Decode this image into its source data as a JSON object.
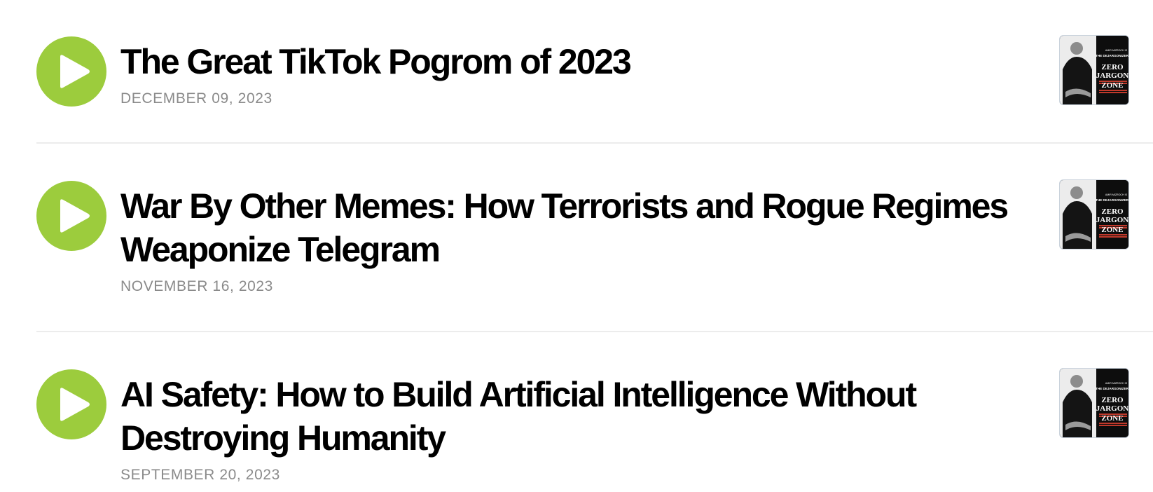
{
  "accent_color": "#9ccc3d",
  "episodes": [
    {
      "title": "The Great TikTok Pogrom of 2023",
      "date": "DECEMBER 09, 2023",
      "play_icon": "play-icon",
      "cover": {
        "byline": "AMIR MIZROCH IS",
        "show": "THE DEJARGONIZER",
        "line1": "ZERO",
        "line2": "JARGON",
        "line3": "ZONE"
      }
    },
    {
      "title": "War By Other Memes: How Terrorists and Rogue Regimes Weaponize Telegram",
      "date": "NOVEMBER 16, 2023",
      "play_icon": "play-icon",
      "cover": {
        "byline": "AMIR MIZROCH IS",
        "show": "THE DEJARGONIZER",
        "line1": "ZERO",
        "line2": "JARGON",
        "line3": "ZONE"
      }
    },
    {
      "title": "AI Safety: How to Build Artificial Intelligence Without Destroying Humanity",
      "date": "SEPTEMBER 20, 2023",
      "play_icon": "play-icon",
      "cover": {
        "byline": "AMIR MIZROCH IS",
        "show": "THE DEJARGONIZER",
        "line1": "ZERO",
        "line2": "JARGON",
        "line3": "ZONE"
      }
    }
  ]
}
